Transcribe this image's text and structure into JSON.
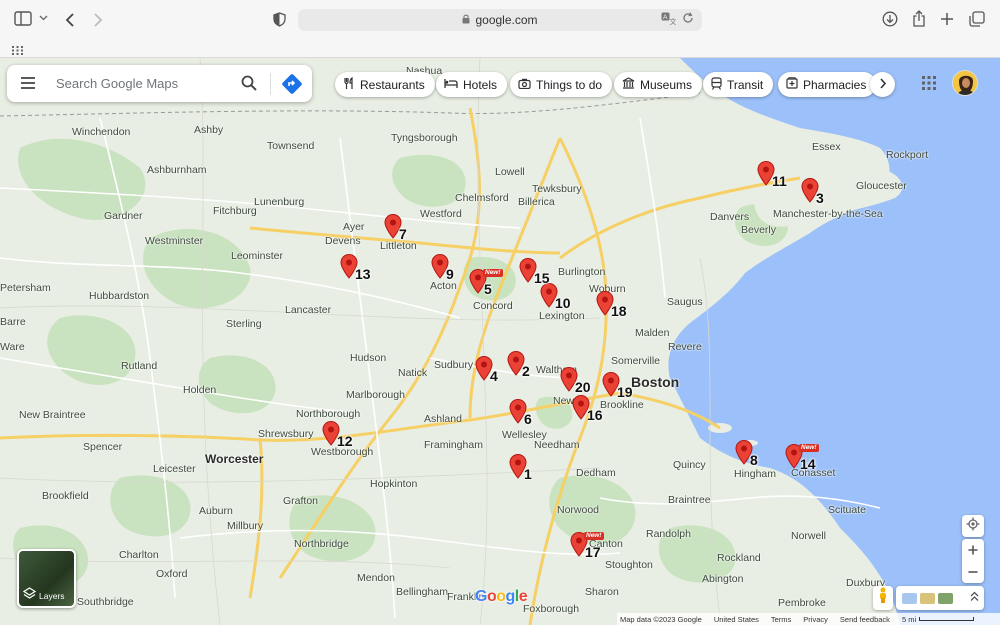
{
  "browser": {
    "url": "google.com",
    "icons": [
      "sidebar-icon",
      "chevron-down-icon",
      "back-icon",
      "forward-icon",
      "shield-icon",
      "translate-icon",
      "reload-icon",
      "download-icon",
      "share-icon",
      "new-tab-icon",
      "tabs-overview-icon",
      "grid-icon"
    ]
  },
  "search": {
    "placeholder": "Search Google Maps"
  },
  "chips": [
    {
      "label": "Restaurants",
      "icon": "fork-knife-icon"
    },
    {
      "label": "Hotels",
      "icon": "bed-icon"
    },
    {
      "label": "Things to do",
      "icon": "camera-icon"
    },
    {
      "label": "Museums",
      "icon": "museum-icon"
    },
    {
      "label": "Transit",
      "icon": "train-icon"
    },
    {
      "label": "Pharmacies",
      "icon": "pharmacy-icon"
    }
  ],
  "map": {
    "cities": {
      "boston": "Boston",
      "worcester": "Worcester"
    },
    "towns": [
      "Nashua",
      "Winchendon",
      "Ashby",
      "Townsend",
      "Tyngsborough",
      "Lowell",
      "Tewksbury",
      "Ashburnham",
      "Fitchburg",
      "Lunenburg",
      "Westford",
      "Chelmsford",
      "Billerica",
      "Gardner",
      "Westminster",
      "Ayer",
      "Devens",
      "Littleton",
      "Leominster",
      "Acton",
      "Concord",
      "Burlington",
      "Woburn",
      "Lexington",
      "Hubbardston",
      "Lancaster",
      "Sterling",
      "Saugus",
      "Malden",
      "Revere",
      "Hudson",
      "Sudbury",
      "Waltham",
      "Somerville",
      "Rutland",
      "Holden",
      "Marlborough",
      "Newton",
      "Brookline",
      "New Braintree",
      "Northborough",
      "Shrewsbury",
      "Westborough",
      "Framingham",
      "Wellesley",
      "Needham",
      "Spencer",
      "Leicester",
      "Hopkinton",
      "Dedham",
      "Quincy",
      "Hingham",
      "Cohasset",
      "Brookfield",
      "Auburn",
      "Grafton",
      "Millbury",
      "Norwood",
      "Braintree",
      "Scituate",
      "Charlton",
      "Northbridge",
      "Canton",
      "Randolph",
      "Rockland",
      "Norwell",
      "Stoughton",
      "Oxford",
      "Mendon",
      "Abington",
      "Southbridge",
      "Bellingham",
      "Franklin",
      "Foxborough",
      "Pembroke",
      "Essex",
      "Rockport",
      "Gloucester",
      "Danvers",
      "Beverly",
      "Manchester-by-the-Sea",
      "Petersham",
      "Barre",
      "Ware",
      "Natick",
      "Ashland",
      "Sharon",
      "Duxbury"
    ],
    "pins": [
      {
        "label": "1"
      },
      {
        "label": "2"
      },
      {
        "label": "3"
      },
      {
        "label": "4"
      },
      {
        "label": "5"
      },
      {
        "label": "6"
      },
      {
        "label": "7"
      },
      {
        "label": "8"
      },
      {
        "label": "9"
      },
      {
        "label": "10"
      },
      {
        "label": "11"
      },
      {
        "label": "12"
      },
      {
        "label": "13"
      },
      {
        "label": "14"
      },
      {
        "label": "15"
      },
      {
        "label": "16"
      },
      {
        "label": "17"
      },
      {
        "label": "18"
      },
      {
        "label": "19"
      },
      {
        "label": "20"
      }
    ],
    "new_badge": "New!"
  },
  "controls": {
    "layers_label": "Layers",
    "logo": "Google"
  },
  "footer": {
    "map_data": "Map data ©2023 Google",
    "country": "United States",
    "terms": "Terms",
    "privacy": "Privacy",
    "feedback": "Send feedback",
    "scale": "5 mi"
  },
  "colors": {
    "land": "#e8eee3",
    "water": "#9cc0f9",
    "park": "#c9e2bf",
    "pin": "#ea4335",
    "highway": "#f6cf65"
  }
}
